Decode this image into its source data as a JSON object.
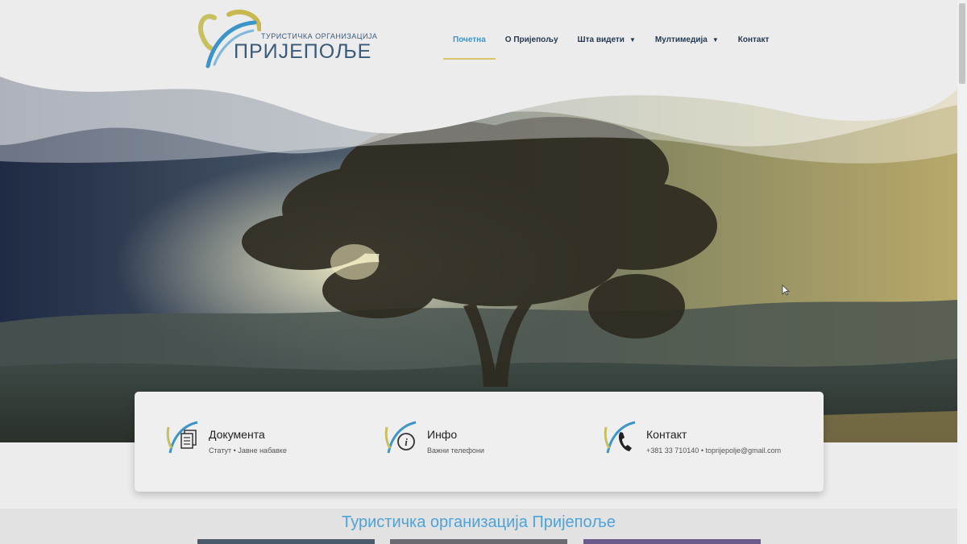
{
  "logo": {
    "top_text": "ТУРИСТИЧКА ОРГАНИЗАЦИЈА",
    "main_text": "ПРИЈЕПОЉЕ"
  },
  "nav": {
    "items": [
      {
        "label": "Почетна",
        "active": true,
        "has_dropdown": false
      },
      {
        "label": "О Пријепољу",
        "active": false,
        "has_dropdown": false
      },
      {
        "label": "Шта видети",
        "active": false,
        "has_dropdown": true
      },
      {
        "label": "Мултимедија",
        "active": false,
        "has_dropdown": true
      },
      {
        "label": "Контакт",
        "active": false,
        "has_dropdown": false
      }
    ]
  },
  "cards": [
    {
      "title": "Документа",
      "subtitle": "Статут • Јавне набавке",
      "icon": "document-icon"
    },
    {
      "title": "Инфо",
      "subtitle": "Важни телефони",
      "icon": "info-icon"
    },
    {
      "title": "Контакт",
      "subtitle": "+381 33 710140 • toprijepolje@gmail.com",
      "icon": "phone-icon"
    }
  ],
  "section": {
    "title": "Туристичка организација Пријепоље"
  },
  "colors": {
    "accent_blue": "#3c95c8",
    "accent_gold": "#d8c46a",
    "nav_text": "#243a52",
    "section_title": "#4ea3d8"
  }
}
